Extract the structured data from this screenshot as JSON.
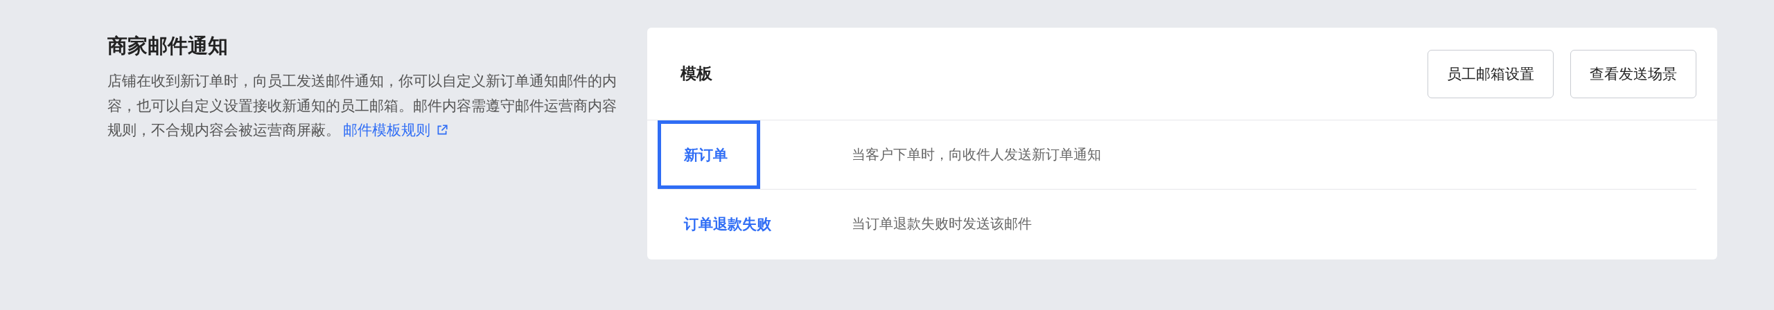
{
  "section": {
    "title": "商家邮件通知",
    "description": "店铺在收到新订单时，向员工发送邮件通知，你可以自定义新订单通知邮件的内容，也可以自定义设置接收新通知的员工邮箱。邮件内容需遵守邮件运营商内容规则，不合规内容会被运营商屏蔽。",
    "link": "邮件模板规则"
  },
  "card": {
    "title": "模板",
    "buttons": [
      "员工邮箱设置",
      "查看发送场景"
    ],
    "rows": [
      {
        "name": "新订单",
        "description": "当客户下单时，向收件人发送新订单通知",
        "selected": true
      },
      {
        "name": "订单退款失败",
        "description": "当订单退款失败时发送该邮件",
        "selected": false
      }
    ]
  }
}
